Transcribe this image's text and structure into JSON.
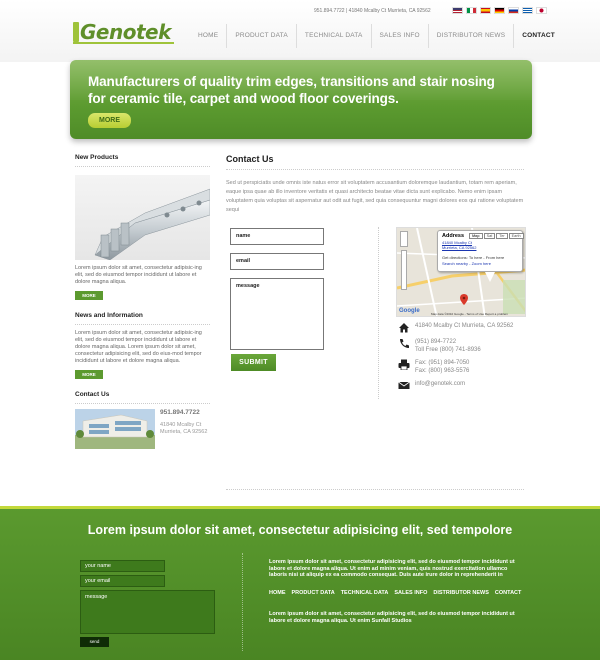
{
  "header": {
    "contact_strip": "951.894.7722 | 41840 Mcalby Ct Murrieta, CA 92562",
    "logo_text": "Genotek",
    "flags": [
      "us-flag-icon",
      "italy-flag-icon",
      "spain-flag-icon",
      "germany-flag-icon",
      "russia-flag-icon",
      "greece-flag-icon",
      "japan-flag-icon"
    ],
    "nav": [
      "HOME",
      "PRODUCT DATA",
      "TECHNICAL DATA",
      "SALES INFO",
      "DISTRIBUTOR NEWS",
      "CONTACT"
    ]
  },
  "hero": {
    "line1": "Manufacturers of quality trim edges, transitions and stair nosing",
    "line2": "for ceramic tile, carpet and wood floor coverings.",
    "more": "MORE"
  },
  "sidebar": {
    "new_products_heading": "New Products",
    "new_products_text": "Lorem ipsum dolor sit amet, consectetur adipisic-ing elit, sed do eiusmod tempor incididunt ut labore et dolore magna aliqua.",
    "more1": "MORE",
    "news_heading": "News and Information",
    "news_text": "Lorem ipsum dolor sit amet, consectetur adipisic-ing elit, sed do eiusmod tempor incididunt ut labore et dolore magna aliqua. Lorem ipsum dolor sit amet, consectetur adipisicing elit, sed do eius-mod tempor incididunt ut labore et dolore magna aliqua.",
    "more2": "MORE",
    "contact_heading": "Contact Us",
    "contact_phone": "951.894.7722",
    "contact_address": "41840 Mcalby Ct Murrieta, CA 92562"
  },
  "main": {
    "heading": "Contact Us",
    "intro": "Sed ut perspiciatis unde omnis iste natus error sit voluptatem accusantium doloremque laudantium, totam rem aperiam, eaque ipsa quae ab illo inventore veritatis et quasi architecto beatae vitae dicta sunt explicabo. Nemo enim ipsam voluptatem quia voluptas sit aspernatur aut odit aut fugit, sed quia consequuntur magni dolores eos qui ratione voluptatem sequi",
    "form": {
      "name": "name",
      "email": "email",
      "message": "message",
      "submit": "SUBMIT"
    }
  },
  "map": {
    "popup_title": "Address",
    "popup_address": "41840 Mcalby Ct Murrieta, CA 92562",
    "popup_directions": "Get directions: To here - From here",
    "popup_search": "Search nearby - Zoom here",
    "map_types": [
      "Map",
      "Sat",
      "Ter",
      "Earth"
    ],
    "attribution": "Map data ©2010 Google - Terms of Use   Report a problem",
    "google": "Google"
  },
  "contact_info": {
    "address": "41840 Mcalby Ct Murrieta, CA 92562",
    "phone": "(951) 894-7722",
    "toll_free": "Toll Free (800) 741-8936",
    "fax1": "Fax: (951) 894-7050",
    "fax2": "Fax: (800) 963-5576",
    "email": "info@genotek.com"
  },
  "footer": {
    "title": "Lorem ipsum dolor sit amet, consectetur adipisicing elit, sed tempolore",
    "form": {
      "name": "your name",
      "email": "your email",
      "message": "message",
      "send": "send"
    },
    "para1": "Lorem ipsum dolor sit amet, consectetur adipisicing elit, sed do eiusmod tempor incididunt ut labore et dolore magna aliqua. Ut enim ad minim veniam, quis nostrud exercitation ullamco laboris nisi ut aliquip ex ea commodo consequat. Duis aute irure dolor in reprehenderit in",
    "nav": [
      "HOME",
      "PRODUCT DATA",
      "TECHNICAL DATA",
      "SALES INFO",
      "DISTRIBUTOR NEWS",
      "CONTACT"
    ],
    "para2": "Lorem ipsum dolor sit amet, consectetur adipisicing elit, sed do eiusmod tempor incididunt ut labore et dolore magna aliqua. Ut enim Sunfall Studios"
  },
  "colors": {
    "accent": "#5b9a2f",
    "accent_light": "#c3d93a",
    "text": "#555555"
  }
}
